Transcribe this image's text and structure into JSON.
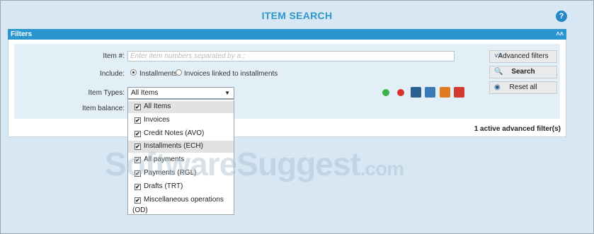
{
  "page": {
    "title": "ITEM SEARCH",
    "help_icon": "question-circle-icon",
    "help_glyph": "?"
  },
  "filters": {
    "header": "Filters",
    "collapse_icon": "double-chevron-up-icon",
    "collapse_glyph": "˄˄",
    "item_label": "Item #:",
    "item_placeholder": "Enter item numbers separated by a ;",
    "include_label": "Include:",
    "include_options": [
      {
        "label": "Installments",
        "selected": true
      },
      {
        "label": "Invoices linked to installments",
        "selected": false
      }
    ],
    "item_types_label": "Item Types:",
    "item_types_selected": "All Items",
    "item_balance_label": "Item balance:",
    "item_types_options": [
      {
        "label": "All Items",
        "checked": true,
        "highlighted": true
      },
      {
        "label": "Invoices",
        "checked": true,
        "highlighted": false
      },
      {
        "label": "Credit Notes (AVO)",
        "checked": true,
        "highlighted": false
      },
      {
        "label": "Installments (ECH)",
        "checked": true,
        "highlighted": true
      },
      {
        "label": "All payments",
        "checked": true,
        "highlighted": false
      },
      {
        "label": "Payments (RGL)",
        "checked": true,
        "highlighted": false
      },
      {
        "label": "Drafts (TRT)",
        "checked": true,
        "highlighted": false
      },
      {
        "label": "Miscellaneous operations",
        "label_cont": "(OD)",
        "checked": true,
        "highlighted": false
      }
    ],
    "check_glyph": "✔",
    "status_icons": [
      {
        "name": "green-dot-icon",
        "color": "#3cb34a"
      },
      {
        "name": "red-dot-icon",
        "color": "#d9302c"
      },
      {
        "name": "inbox-blue-icon",
        "color": "#2c5f8e"
      },
      {
        "name": "inbox-blue-outline-icon",
        "color": "#3a7ab8"
      },
      {
        "name": "inbox-orange-icon",
        "color": "#e07b24"
      },
      {
        "name": "inbox-red-icon",
        "color": "#d33a2e"
      }
    ],
    "buttons": {
      "advanced": {
        "label": "Advanced filters",
        "icon": "double-chevron-down-icon",
        "glyph": "˅˅"
      },
      "search": {
        "label": "Search",
        "icon": "magnifier-icon",
        "glyph": "🔍"
      },
      "reset": {
        "label": "Reset all",
        "icon": "eraser-icon",
        "glyph": "◉"
      }
    },
    "active_filters": "1 active advanced filter(s)"
  },
  "watermark": {
    "main": "SoftwareSuggest",
    "suffix": ".com"
  }
}
